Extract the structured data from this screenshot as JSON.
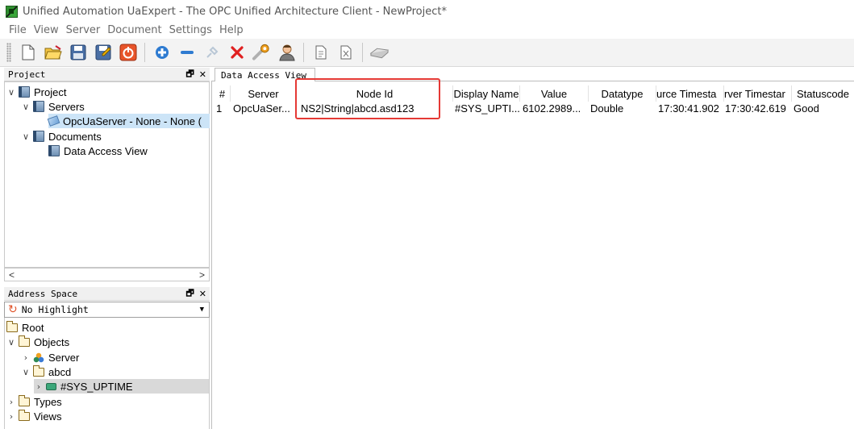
{
  "window": {
    "title": "Unified Automation UaExpert - The OPC Unified Architecture Client - NewProject*"
  },
  "menu": [
    "File",
    "View",
    "Server",
    "Document",
    "Settings",
    "Help"
  ],
  "toolbar": {
    "buttons": [
      "new-document-icon",
      "open-folder-icon",
      "save-icon",
      "save-as-icon",
      "power-icon",
      "add-server-icon",
      "remove-server-icon",
      "connect-icon",
      "disconnect-icon",
      "settings-icon",
      "user-icon",
      "add-document-icon",
      "remove-document-icon",
      "network-icon"
    ]
  },
  "project_panel": {
    "title": "Project",
    "buttons": "ғ ×",
    "tree": {
      "project": "Project",
      "servers": "Servers",
      "server_item": "OpcUaServer - None - None (",
      "documents": "Documents",
      "data_access_view": "Data Access View"
    },
    "scroll_left": "<",
    "scroll_right": ">"
  },
  "address_panel": {
    "title": "Address Space",
    "buttons": "ғ ×",
    "highlight": "No Highlight",
    "tree": {
      "root": "Root",
      "objects": "Objects",
      "server": "Server",
      "abcd": "abcd",
      "sys_uptime": "#SYS_UPTIME",
      "types": "Types",
      "views": "Views"
    }
  },
  "document_tab": {
    "label": "Data Access View"
  },
  "grid": {
    "columns": [
      "#",
      "Server",
      "Node Id",
      "Display Name",
      "Value",
      "Datatype",
      "urce Timesta",
      "rver Timestar",
      "Statuscode"
    ],
    "rows": [
      [
        "1",
        "OpcUaSer...",
        "NS2|String|abcd.asd123",
        "#SYS_UPTI...",
        "6102.2989...",
        "Double",
        "17:30:41.902",
        "17:30:42.619",
        "Good"
      ]
    ]
  },
  "colors": {
    "highlight_box": "#e53935",
    "selection": "#cce4f7"
  }
}
